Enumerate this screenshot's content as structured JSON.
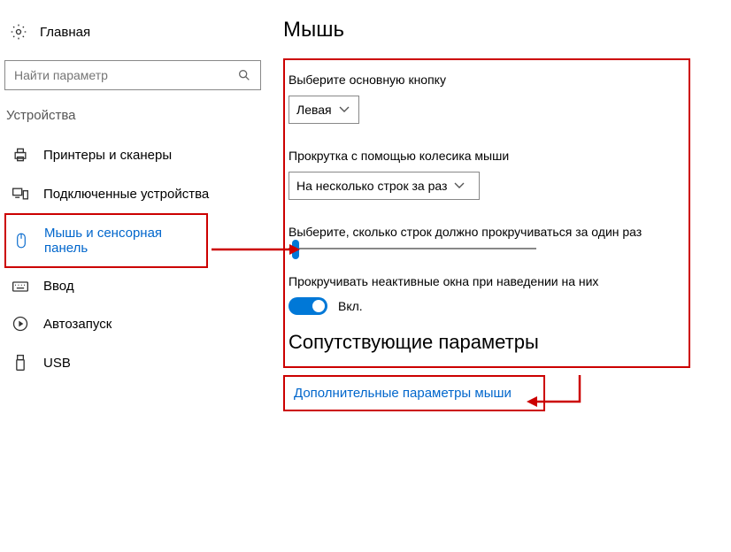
{
  "sidebar": {
    "home_label": "Главная",
    "search_placeholder": "Найти параметр",
    "category_label": "Устройства",
    "items": [
      {
        "label": "Принтеры и сканеры"
      },
      {
        "label": "Подключенные устройства"
      },
      {
        "label": "Мышь и сенсорная панель"
      },
      {
        "label": "Ввод"
      },
      {
        "label": "Автозапуск"
      },
      {
        "label": "USB"
      }
    ]
  },
  "main": {
    "title": "Мышь",
    "primary_button_label": "Выберите основную кнопку",
    "primary_button_value": "Левая",
    "scroll_wheel_label": "Прокрутка с помощью колесика мыши",
    "scroll_wheel_value": "На несколько строк за раз",
    "lines_label": "Выберите, сколько строк должно прокручиваться за один раз",
    "inactive_label": "Прокручивать неактивные окна при наведении на них",
    "toggle_state": "Вкл.",
    "related_title": "Сопутствующие параметры",
    "related_link": "Дополнительные параметры мыши"
  },
  "annotation": {
    "arrow_color": "#cc0000"
  }
}
